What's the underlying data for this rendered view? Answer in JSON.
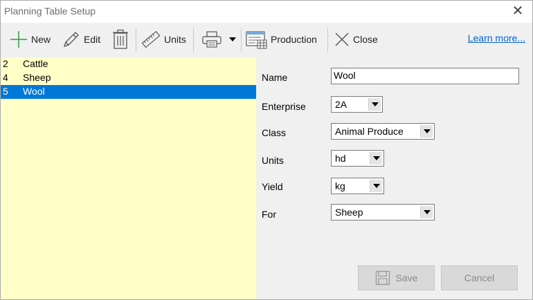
{
  "window": {
    "title": "Planning Table Setup",
    "close_symbol": "✕"
  },
  "toolbar": {
    "new_label": "New",
    "edit_label": "Edit",
    "units_label": "Units",
    "production_label": "Production",
    "close_label": "Close",
    "learn_more": "Learn more..."
  },
  "list": {
    "items": [
      {
        "num": "2",
        "label": "Cattle",
        "selected": false
      },
      {
        "num": "4",
        "label": "Sheep",
        "selected": false
      },
      {
        "num": "5",
        "label": "Wool",
        "selected": true
      }
    ]
  },
  "form": {
    "name_label": "Name",
    "name_value": "Wool",
    "enterprise_label": "Enterprise",
    "enterprise_value": "2A",
    "class_label": "Class",
    "class_value": "Animal Produce",
    "units_label": "Units",
    "units_value": "hd",
    "yield_label": "Yield",
    "yield_value": "kg",
    "for_label": "For",
    "for_value": "Sheep"
  },
  "actions": {
    "save_label": "Save",
    "cancel_label": "Cancel"
  },
  "colors": {
    "list_bg": "#ffffc8",
    "selection": "#0078d7",
    "link": "#0066cc"
  }
}
